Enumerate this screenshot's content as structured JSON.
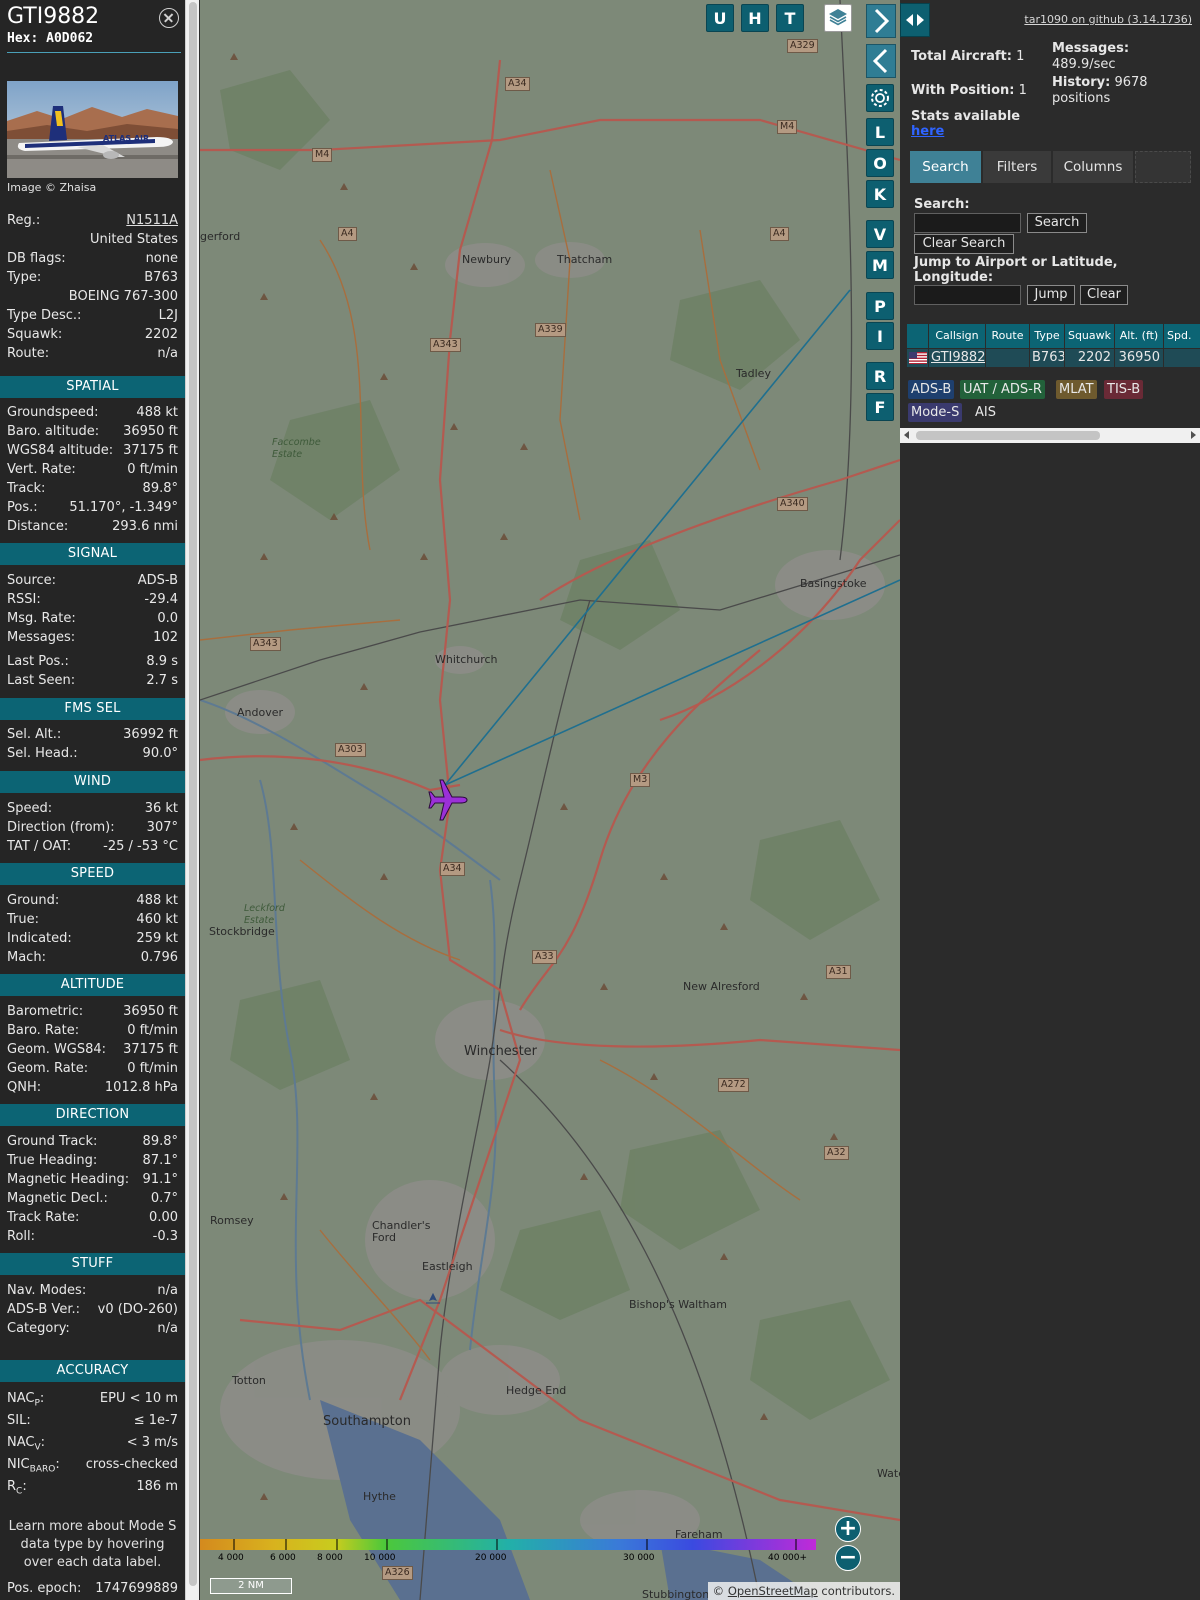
{
  "aircraft": {
    "callsign": "GTI9882",
    "hex_label": "Hex:",
    "hex": "A0D062",
    "image_credit": "Image © Zhaisa",
    "livery_text": "ATLAS AIR"
  },
  "basic": [
    {
      "label": "Reg.:",
      "value": "N1511A",
      "link": true
    },
    {
      "label": "",
      "value": "United States"
    },
    {
      "label": "DB flags:",
      "value": "none"
    },
    {
      "label": "Type:",
      "value": "B763"
    },
    {
      "label": "",
      "value": "BOEING 767-300"
    },
    {
      "label": "Type Desc.:",
      "value": "L2J"
    },
    {
      "label": "Squawk:",
      "value": "2202"
    },
    {
      "label": "Route:",
      "value": "n/a"
    }
  ],
  "sections": {
    "spatial": "SPATIAL",
    "signal": "SIGNAL",
    "fms": "FMS SEL",
    "wind": "WIND",
    "speed": "SPEED",
    "altitude": "ALTITUDE",
    "direction": "DIRECTION",
    "stuff": "STUFF",
    "accuracy": "ACCURACY"
  },
  "spatial": [
    {
      "label": "Groundspeed:",
      "value": "488 kt"
    },
    {
      "label": "Baro. altitude:",
      "value": "36950 ft"
    },
    {
      "label": "WGS84 altitude:",
      "value": "37175 ft"
    },
    {
      "label": "Vert. Rate:",
      "value": "0 ft/min"
    },
    {
      "label": "Track:",
      "value": "89.8°"
    },
    {
      "label": "Pos.:",
      "value": "51.170°, -1.349°"
    },
    {
      "label": "Distance:",
      "value": "293.6 nmi"
    }
  ],
  "signal": [
    {
      "label": "Source:",
      "value": "ADS-B"
    },
    {
      "label": "RSSI:",
      "value": "-29.4"
    },
    {
      "label": "Msg. Rate:",
      "value": "0.0"
    },
    {
      "label": "Messages:",
      "value": "102"
    },
    {
      "label": "Last Pos.:",
      "value": "8.9 s"
    },
    {
      "label": "Last Seen:",
      "value": "2.7 s"
    }
  ],
  "fms": [
    {
      "label": "Sel. Alt.:",
      "value": "36992 ft"
    },
    {
      "label": "Sel. Head.:",
      "value": "90.0°"
    }
  ],
  "wind": [
    {
      "label": "Speed:",
      "value": "36 kt"
    },
    {
      "label": "Direction (from):",
      "value": "307°"
    },
    {
      "label": "TAT / OAT:",
      "value": "-25 / -53 °C"
    }
  ],
  "speed": [
    {
      "label": "Ground:",
      "value": "488 kt"
    },
    {
      "label": "True:",
      "value": "460 kt"
    },
    {
      "label": "Indicated:",
      "value": "259 kt"
    },
    {
      "label": "Mach:",
      "value": "0.796"
    }
  ],
  "altitude": [
    {
      "label": "Barometric:",
      "value": "36950 ft"
    },
    {
      "label": "Baro. Rate:",
      "value": "0 ft/min"
    },
    {
      "label": "Geom. WGS84:",
      "value": "37175 ft"
    },
    {
      "label": "Geom. Rate:",
      "value": "0 ft/min"
    },
    {
      "label": "QNH:",
      "value": "1012.8 hPa"
    }
  ],
  "direction": [
    {
      "label": "Ground Track:",
      "value": "89.8°"
    },
    {
      "label": "True Heading:",
      "value": "87.1°"
    },
    {
      "label": "Magnetic Heading:",
      "value": "91.1°"
    },
    {
      "label": "Magnetic Decl.:",
      "value": "0.7°"
    },
    {
      "label": "Track Rate:",
      "value": "0.00"
    },
    {
      "label": "Roll:",
      "value": "-0.3"
    }
  ],
  "stuff": [
    {
      "label": "Nav. Modes:",
      "value": "n/a"
    },
    {
      "label": "ADS-B Ver.:",
      "value": "v0 (DO-260)"
    },
    {
      "label": "Category:",
      "value": "n/a"
    }
  ],
  "accuracy": [
    {
      "label": "NAC",
      "sub": "P",
      "value": "EPU < 10 m"
    },
    {
      "label": "SIL:",
      "sub": "",
      "value": "≤ 1e-7"
    },
    {
      "label": "NAC",
      "sub": "V",
      "value": "< 3 m/s"
    },
    {
      "label": "NIC",
      "sub": "BARO",
      "value": "cross-checked"
    },
    {
      "label": "R",
      "sub": "C",
      "value": "186 m"
    }
  ],
  "help_text": "Learn more about Mode S data type by hovering over each data label.",
  "pos_epoch": {
    "label": "Pos. epoch:",
    "value": "1747699889"
  },
  "map": {
    "toolbar_top": [
      "U",
      "H",
      "T"
    ],
    "side_buttons": [
      "L",
      "O",
      "K",
      "V",
      "M",
      "P",
      "I",
      "R",
      "F"
    ],
    "places": [
      {
        "name": "gerford",
        "big": false
      },
      {
        "name": "Newbury",
        "big": false
      },
      {
        "name": "Thatcham",
        "big": false
      },
      {
        "name": "Tadley",
        "big": false
      },
      {
        "name": "Faccombe Estate",
        "big": false
      },
      {
        "name": "Basingstoke",
        "big": false
      },
      {
        "name": "Whitchurch",
        "big": false
      },
      {
        "name": "Andover",
        "big": false
      },
      {
        "name": "Leckford Estate",
        "big": false
      },
      {
        "name": "Stockbridge",
        "big": false
      },
      {
        "name": "New Alresford",
        "big": false
      },
      {
        "name": "Winchester",
        "big": true
      },
      {
        "name": "Romsey",
        "big": false
      },
      {
        "name": "Chandler's Ford",
        "big": false
      },
      {
        "name": "Eastleigh",
        "big": false
      },
      {
        "name": "Bishop's Waltham",
        "big": false
      },
      {
        "name": "Totton",
        "big": false
      },
      {
        "name": "Hedge End",
        "big": false
      },
      {
        "name": "Southampton",
        "big": true
      },
      {
        "name": "Hythe",
        "big": false
      },
      {
        "name": "Fareham",
        "big": false
      },
      {
        "name": "Wate",
        "big": false
      },
      {
        "name": "Stubbington",
        "big": false
      }
    ],
    "roads": [
      "A329",
      "A34",
      "M4",
      "M4",
      "A4",
      "A4",
      "A339",
      "A343",
      "A340",
      "A343",
      "A303",
      "M3",
      "A34",
      "A33",
      "A31",
      "A272",
      "A32",
      "A326"
    ],
    "alt_legend": [
      "4 000",
      "6 000",
      "8 000",
      "10 000",
      "20 000",
      "30 000",
      "40 000+"
    ],
    "scale": "2 NM",
    "attribution_prefix": "© ",
    "attribution_link": "OpenStreetMap",
    "attribution_suffix": " contributors."
  },
  "panel": {
    "github_link": "tar1090 on github (3.14.1736)",
    "total_aircraft_label": "Total Aircraft:",
    "total_aircraft": "1",
    "with_position_label": "With Position:",
    "with_position": "1",
    "messages_label": "Messages:",
    "messages_rate": "489.9/sec",
    "history_label": "History:",
    "history_value": "9678",
    "history_unit": "positions",
    "stats_label": "Stats available",
    "stats_link": "here",
    "tabs": [
      "Search",
      "Filters",
      "Columns"
    ],
    "search_label": "Search:",
    "search_value": "",
    "search_button": "Search",
    "clear_search_button": "Clear Search",
    "jump_label": "Jump to Airport or Latitude, Longitude:",
    "jump_value": "",
    "jump_button": "Jump",
    "clear_button": "Clear",
    "table_headers": [
      "",
      "Callsign",
      "Route",
      "Type",
      "Squawk",
      "Alt. (ft)",
      "Spd."
    ],
    "table_rows": [
      {
        "flag": "us-flag",
        "callsign": "GTI9882",
        "route": "",
        "type": "B763",
        "squawk": "2202",
        "alt": "36950",
        "spd": ""
      }
    ],
    "sources": [
      {
        "label": "ADS-B",
        "color": "#1e3f6e"
      },
      {
        "label": "UAT / ADS-R",
        "color": "#22613a"
      },
      {
        "label": "MLAT",
        "color": "#6e5a2e"
      },
      {
        "label": "TIS-B",
        "color": "#6a2a36"
      },
      {
        "label": "Mode-S",
        "color": "#3a3a6e"
      },
      {
        "label": "AIS",
        "color": ""
      }
    ]
  },
  "colors": {
    "accent": "#0c6474",
    "track_line": "#1f6f8f",
    "aircraft": "#9b30d8"
  }
}
